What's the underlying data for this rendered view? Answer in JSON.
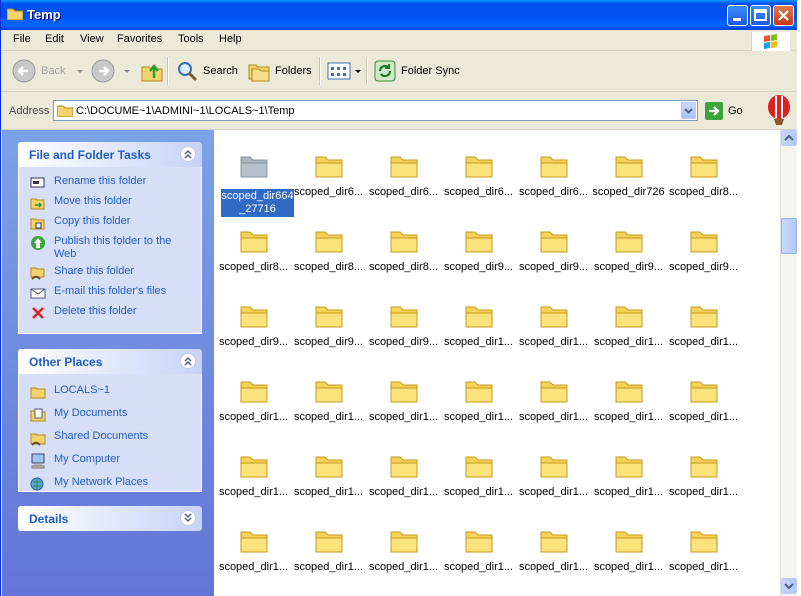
{
  "window": {
    "title": "Temp"
  },
  "menu": [
    "File",
    "Edit",
    "View",
    "Favorites",
    "Tools",
    "Help"
  ],
  "toolbar": {
    "back": "Back",
    "search": "Search",
    "folders": "Folders",
    "folder_sync": "Folder Sync"
  },
  "address": {
    "label": "Address",
    "path": "C:\\DOCUME~1\\ADMINI~1\\LOCALS~1\\Temp",
    "go": "Go"
  },
  "tasks": {
    "title": "File and Folder Tasks",
    "items": [
      {
        "label": "Rename this folder",
        "icon": "rename-icon"
      },
      {
        "label": "Move this folder",
        "icon": "move-icon"
      },
      {
        "label": "Copy this folder",
        "icon": "copy-icon"
      },
      {
        "label": "Publish this folder to the Web",
        "icon": "publish-web-icon"
      },
      {
        "label": "Share this folder",
        "icon": "share-icon"
      },
      {
        "label": "E-mail this folder's files",
        "icon": "email-icon"
      },
      {
        "label": "Delete this folder",
        "icon": "delete-icon"
      }
    ]
  },
  "places": {
    "title": "Other Places",
    "items": [
      {
        "label": "LOCALS~1",
        "icon": "folder-icon"
      },
      {
        "label": "My Documents",
        "icon": "my-documents-icon"
      },
      {
        "label": "Shared Documents",
        "icon": "shared-documents-icon"
      },
      {
        "label": "My Computer",
        "icon": "my-computer-icon"
      },
      {
        "label": "My Network Places",
        "icon": "network-places-icon"
      }
    ]
  },
  "details": {
    "title": "Details"
  },
  "files": [
    "scoped_dir664_27716",
    "scoped_dir6...",
    "scoped_dir6...",
    "scoped_dir6...",
    "scoped_dir6...",
    "scoped_dir726",
    "scoped_dir8...",
    "scoped_dir8...",
    "scoped_dir8...",
    "scoped_dir8...",
    "scoped_dir9...",
    "scoped_dir9...",
    "scoped_dir9...",
    "scoped_dir9...",
    "scoped_dir9...",
    "scoped_dir9...",
    "scoped_dir9...",
    "scoped_dir1...",
    "scoped_dir1...",
    "scoped_dir1...",
    "scoped_dir1...",
    "scoped_dir1...",
    "scoped_dir1...",
    "scoped_dir1...",
    "scoped_dir1...",
    "scoped_dir1...",
    "scoped_dir1...",
    "scoped_dir1...",
    "scoped_dir1...",
    "scoped_dir1...",
    "scoped_dir1...",
    "scoped_dir1...",
    "scoped_dir1...",
    "scoped_dir1...",
    "scoped_dir1...",
    "scoped_dir1...",
    "scoped_dir1...",
    "scoped_dir1...",
    "scoped_dir1...",
    "scoped_dir1...",
    "scoped_dir1...",
    "scoped_dir1..."
  ],
  "selected_file": "scoped_dir664_27716",
  "colors": {
    "titlebar": "#0058ee",
    "taskpane_bg": "#6f8fe0",
    "link": "#215dc6",
    "selection": "#316ac5",
    "folder": "#f5d35a"
  }
}
